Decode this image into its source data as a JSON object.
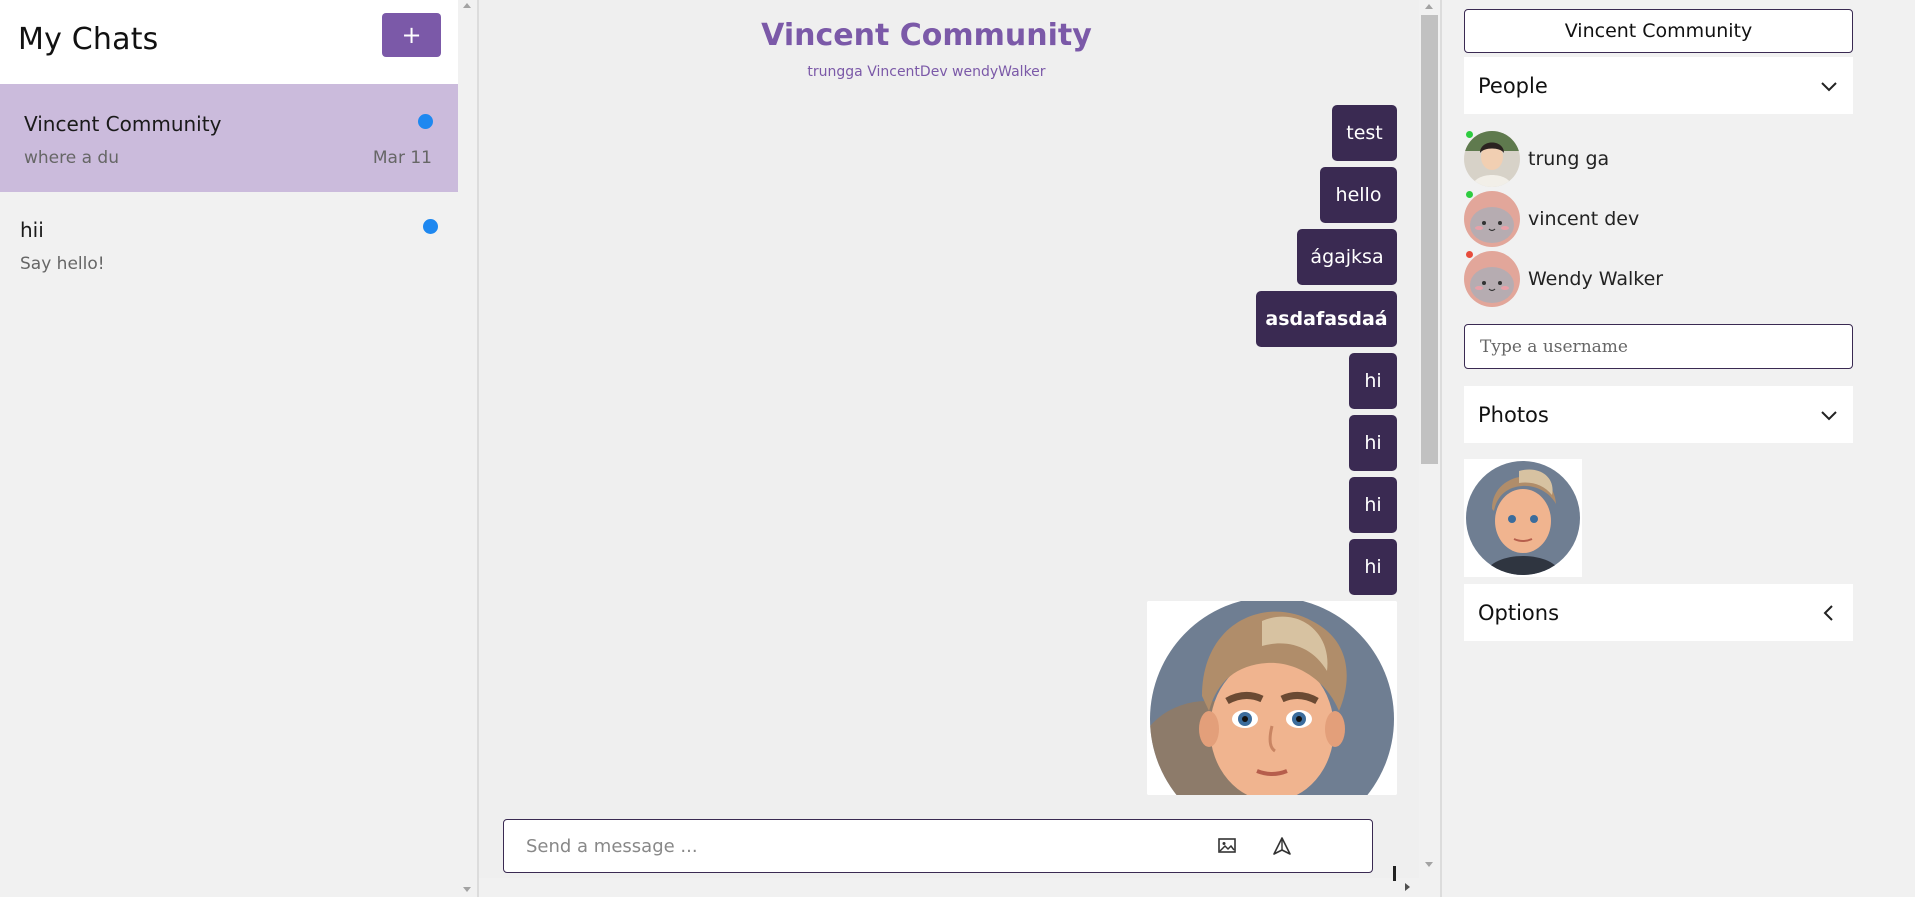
{
  "sidebar": {
    "title": "My Chats",
    "new_button_label": "+",
    "chats": [
      {
        "name": "Vincent Community",
        "preview": "where a du",
        "date": "Mar 11",
        "unread": true,
        "active": true
      },
      {
        "name": "hii",
        "preview": "Say hello!",
        "date": "",
        "unread": true,
        "active": false
      }
    ]
  },
  "chat": {
    "title": "Vincent Community",
    "members": "trungga VincentDev wendyWalker",
    "messages": [
      {
        "text": "test",
        "bold": false
      },
      {
        "text": "hello",
        "bold": false
      },
      {
        "text": "ágajksa",
        "bold": false
      },
      {
        "text": "asdafasdaá",
        "bold": true
      },
      {
        "text": "hi",
        "bold": false
      },
      {
        "text": "hi",
        "bold": false
      },
      {
        "text": "hi",
        "bold": false
      },
      {
        "text": "hi",
        "bold": false
      }
    ],
    "composer": {
      "placeholder": "Send a message ...",
      "image_icon": "image-icon",
      "send_icon": "send-icon"
    }
  },
  "details": {
    "title": "Vincent Community",
    "people_label": "People",
    "people": [
      {
        "name": "trung ga",
        "status_color": "#2ecc40",
        "avatar": "photo-avatar"
      },
      {
        "name": "vincent dev",
        "status_color": "#2ecc40",
        "avatar": "cartoon-avatar"
      },
      {
        "name": "Wendy Walker",
        "status_color": "#e74c3c",
        "avatar": "cartoon-avatar"
      }
    ],
    "username_placeholder": "Type a username",
    "photos_label": "Photos",
    "options_label": "Options"
  },
  "colors": {
    "accent": "#7b59a8",
    "message_bg": "#3a2a52",
    "active_chat_bg": "#cbbbdc",
    "unread_dot": "#1e88f0"
  }
}
